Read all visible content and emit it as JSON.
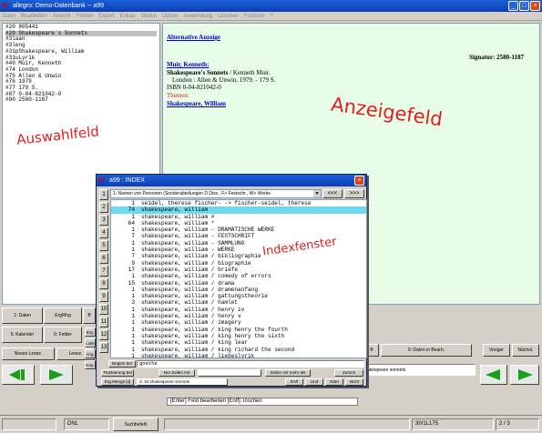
{
  "app": {
    "title": "allegro: Demo-Datenbank -- a99",
    "menu": [
      "Datei",
      "Bearbeiten",
      "Ansicht",
      "Finden",
      "Export",
      "Extras",
      "Global",
      "Option",
      "Anwendung",
      "Löschen",
      "Fußform",
      "?"
    ]
  },
  "record_list": [
    "#20 805441",
    "#20 Shakespeare´s Sonnets",
    "#3laan",
    "#3leng",
    "#31pShakespeare, William",
    "#31uLyrik",
    "#40 Muir, Kenneth",
    "#74 London",
    "#75 Allen & Unwin",
    "#76 1979",
    "#77 179 S.",
    "#87 0-04-821042-0",
    "#90 2580-1187"
  ],
  "annotations": {
    "left": "Auswahlfeld",
    "right": "Anzeigefeld",
    "index": "Indexfenster"
  },
  "display": {
    "alt_link": "Alternative Anzeige",
    "signatur": "Signatur: 2580-1187",
    "author_link": "Muir, Kenneth:",
    "title_bold": "Shakespeare's Sonnets",
    "title_rest": " / Kenneth Muir.",
    "imprint": "London : Allen & Unwin, 1979. - 179 S.",
    "isbn": "ISBN 0-04-821042-0",
    "themen_label": "Themen:",
    "themen_link": "Shakespeare, William"
  },
  "buttons": {
    "daten": "1: Daten",
    "ergmng": "ErgMng",
    "kalender": "5: Kalender",
    "felder": "6: Felder",
    "neues_lesez": "Neues Lesez.",
    "lesez": "Lesez.",
    "daten_bearb": "0: Daten in Bearb.",
    "voriger": "Voriger",
    "naechst": "Nächst.",
    "suchbefehl": "Suchbefehl",
    "btn_b": "B",
    "side_erg": "Erg.",
    "side_liste": "Liste",
    "side_ang": "Ang.",
    "side_kop": "Kop.",
    "right_msg": "akespeare sonnets"
  },
  "status": {
    "dnl": "DNL",
    "message": "[Enter] Feld bearbeiten   [Entf]: löschen",
    "pos1": "30/1L175",
    "pos2": "2 / 3"
  },
  "index_window": {
    "title": "a99 : INDEX",
    "selector": "1: Namen von Personen (Sonderabteilungen D Diss., F> Festschr., W> Werke",
    "nav_prev": "<<<",
    "nav_next": ">>>",
    "numbers": [
      "1",
      "2",
      "3",
      "4",
      "5",
      "6",
      "7",
      "8",
      "9",
      "10",
      "11",
      "12",
      "13"
    ],
    "rows": [
      {
        "count": "1",
        "text": "seidel, therese fischer- -> fischer-seidel, therese"
      },
      {
        "count": "74",
        "text": "shakespeare, william"
      },
      {
        "count": "1",
        "text": "shakespeare, william #"
      },
      {
        "count": "64",
        "text": "shakespeare, william *"
      },
      {
        "count": "1",
        "text": "shakespeare, william - DRAMATISCHE WERKE"
      },
      {
        "count": "7",
        "text": "shakespeare, william - FESTSCHRIFT"
      },
      {
        "count": "1",
        "text": "shakespeare, william - SAMMLUNG"
      },
      {
        "count": "1",
        "text": "shakespeare, william - WERKE"
      },
      {
        "count": "7",
        "text": "shakespeare, william / bibliographie"
      },
      {
        "count": "9",
        "text": "shakespeare, william / biographie"
      },
      {
        "count": "17",
        "text": "shakespeare, william / briefe"
      },
      {
        "count": "1",
        "text": "shakespeare, william / comedy of errors"
      },
      {
        "count": "15",
        "text": "shakespeare, william / drama"
      },
      {
        "count": "1",
        "text": "shakespeare, william / dramenanfang"
      },
      {
        "count": "1",
        "text": "shakespeare, william / gattungstheorie"
      },
      {
        "count": "3",
        "text": "shakespeare, william / hamlet"
      },
      {
        "count": "1",
        "text": "shakespeare, william / henry iv"
      },
      {
        "count": "1",
        "text": "shakespeare, william / henry v"
      },
      {
        "count": "1",
        "text": "shakespeare, william / imagery"
      },
      {
        "count": "1",
        "text": "shakespeare, william / king henry the fourth"
      },
      {
        "count": "1",
        "text": "shakespeare, william / king henry the sixth"
      },
      {
        "count": "1",
        "text": "shakespeare, william / king lear"
      },
      {
        "count": "1",
        "text": "shakespeare, william / king richard the second"
      },
      {
        "count": "1",
        "text": "shakespeare, william / liebeslyrik"
      }
    ],
    "highlight_index": 1,
    "begin_label": "Beginn bei",
    "begin_value": "goethe",
    "trunk_label": "Trunkierung bei",
    "nur_zeilen": "Nur Zeilen mit",
    "zeilen_mit": "Zeilen mit mehr als",
    "zurueck": "Zurück",
    "erg_menge": "Erg.Menge [s]",
    "erg_value": "3: 34 shakespeare sonnets",
    "entf": "Entf",
    "und": "Und",
    "oder": "Oder",
    "nicht": "Nicht"
  }
}
